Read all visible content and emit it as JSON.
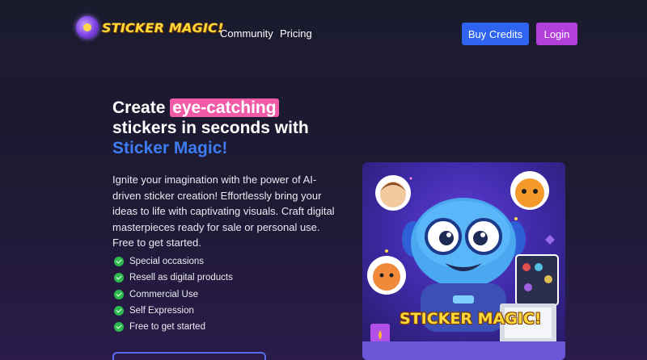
{
  "nav": {
    "logo_text": "STICKER MAGIC!",
    "links": [
      "Community",
      "Pricing"
    ],
    "buy_credits": "Buy Credits",
    "login": "Login"
  },
  "hero": {
    "headline_part1": "Create ",
    "headline_highlight": "eye-catching",
    "headline_part2": " stickers in seconds with ",
    "headline_brand": "Sticker Magic!",
    "description": "Ignite your imagination with the power of AI-driven sticker creation! Effortlessly bring your ideas to life with captivating visuals. Craft digital masterpieces ready for sale or personal use. Free to get started.",
    "features": [
      "Special occasions",
      "Resell as digital products",
      "Commercial Use",
      "Self Expression",
      "Free to get started"
    ]
  },
  "illustration": {
    "banner_text": "STICKER MAGIC!"
  },
  "colors": {
    "background": "#1b1b2e",
    "accent_blue": "#2f64f0",
    "accent_purple": "#b23fd9",
    "highlight_pink": "#f05aa6",
    "brand_blue": "#3d7cf5",
    "check_green": "#2dbb4f",
    "logo_yellow": "#ffd83a"
  },
  "icons": [
    "logo-badge-icon",
    "check-circle-icon"
  ]
}
